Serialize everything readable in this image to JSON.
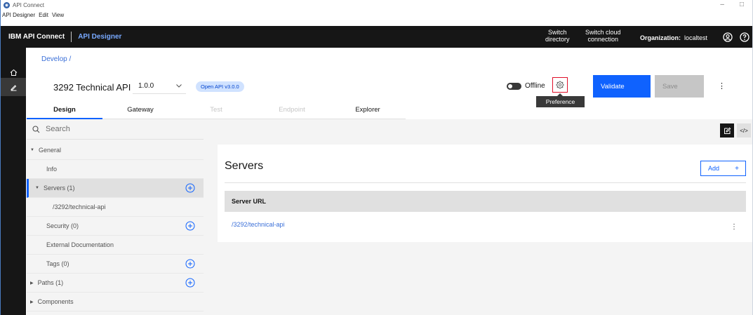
{
  "window": {
    "title": "API Connect",
    "controls": [
      "–",
      "□"
    ]
  },
  "menubar": [
    "API Designer",
    "Edit",
    "View"
  ],
  "header": {
    "brand": "IBM API Connect",
    "product": "API Designer",
    "switch_directory": [
      "Switch",
      "directory"
    ],
    "switch_cloud": [
      "Switch cloud",
      "connection"
    ],
    "org_label": "Organization:",
    "org_value": "localtest",
    "icons": [
      "user-icon",
      "help-icon"
    ]
  },
  "rail": {
    "items": [
      "home-icon",
      "edit-icon"
    ]
  },
  "breadcrumb": "Develop /",
  "api": {
    "title": "3292 Technical API",
    "version": "1.0.0",
    "spec_tag": "Open API v3.0.0"
  },
  "toolbar": {
    "offline_label": "Offline",
    "preference_tooltip": "Preference",
    "validate_label": "Validate",
    "save_label": "Save",
    "overflow": "⋮"
  },
  "tabs": [
    {
      "label": "Design",
      "state": "active"
    },
    {
      "label": "Gateway",
      "state": "normal"
    },
    {
      "label": "Test",
      "state": "disabled"
    },
    {
      "label": "Endpoint",
      "state": "disabled"
    },
    {
      "label": "Explorer",
      "state": "normal"
    }
  ],
  "nav": {
    "search_placeholder": "Search",
    "items": [
      {
        "label": "General",
        "caret": "▼",
        "plus": false
      },
      {
        "label": "Info",
        "caret": "",
        "plus": false
      },
      {
        "label": "Servers (1)",
        "caret": "▼",
        "plus": true,
        "selected": true
      },
      {
        "label": "/3292/technical-api",
        "caret": "",
        "plus": false
      },
      {
        "label": "Security (0)",
        "caret": "",
        "plus": true
      },
      {
        "label": "External Documentation",
        "caret": "",
        "plus": false
      },
      {
        "label": "Tags (0)",
        "caret": "",
        "plus": true
      },
      {
        "label": "Paths (1)",
        "caret": "▶",
        "plus": true
      },
      {
        "label": "Components",
        "caret": "▶",
        "plus": false
      }
    ]
  },
  "servers": {
    "title": "Servers",
    "add_label": "Add",
    "add_plus": "+",
    "column_header": "Server URL",
    "rows": [
      {
        "url": "/3292/technical-api"
      }
    ],
    "row_overflow": "⋮",
    "source_label": "</>"
  },
  "colors": {
    "accent": "#0f62fe",
    "header_bg": "#161616",
    "highlight": "#e0102a"
  }
}
